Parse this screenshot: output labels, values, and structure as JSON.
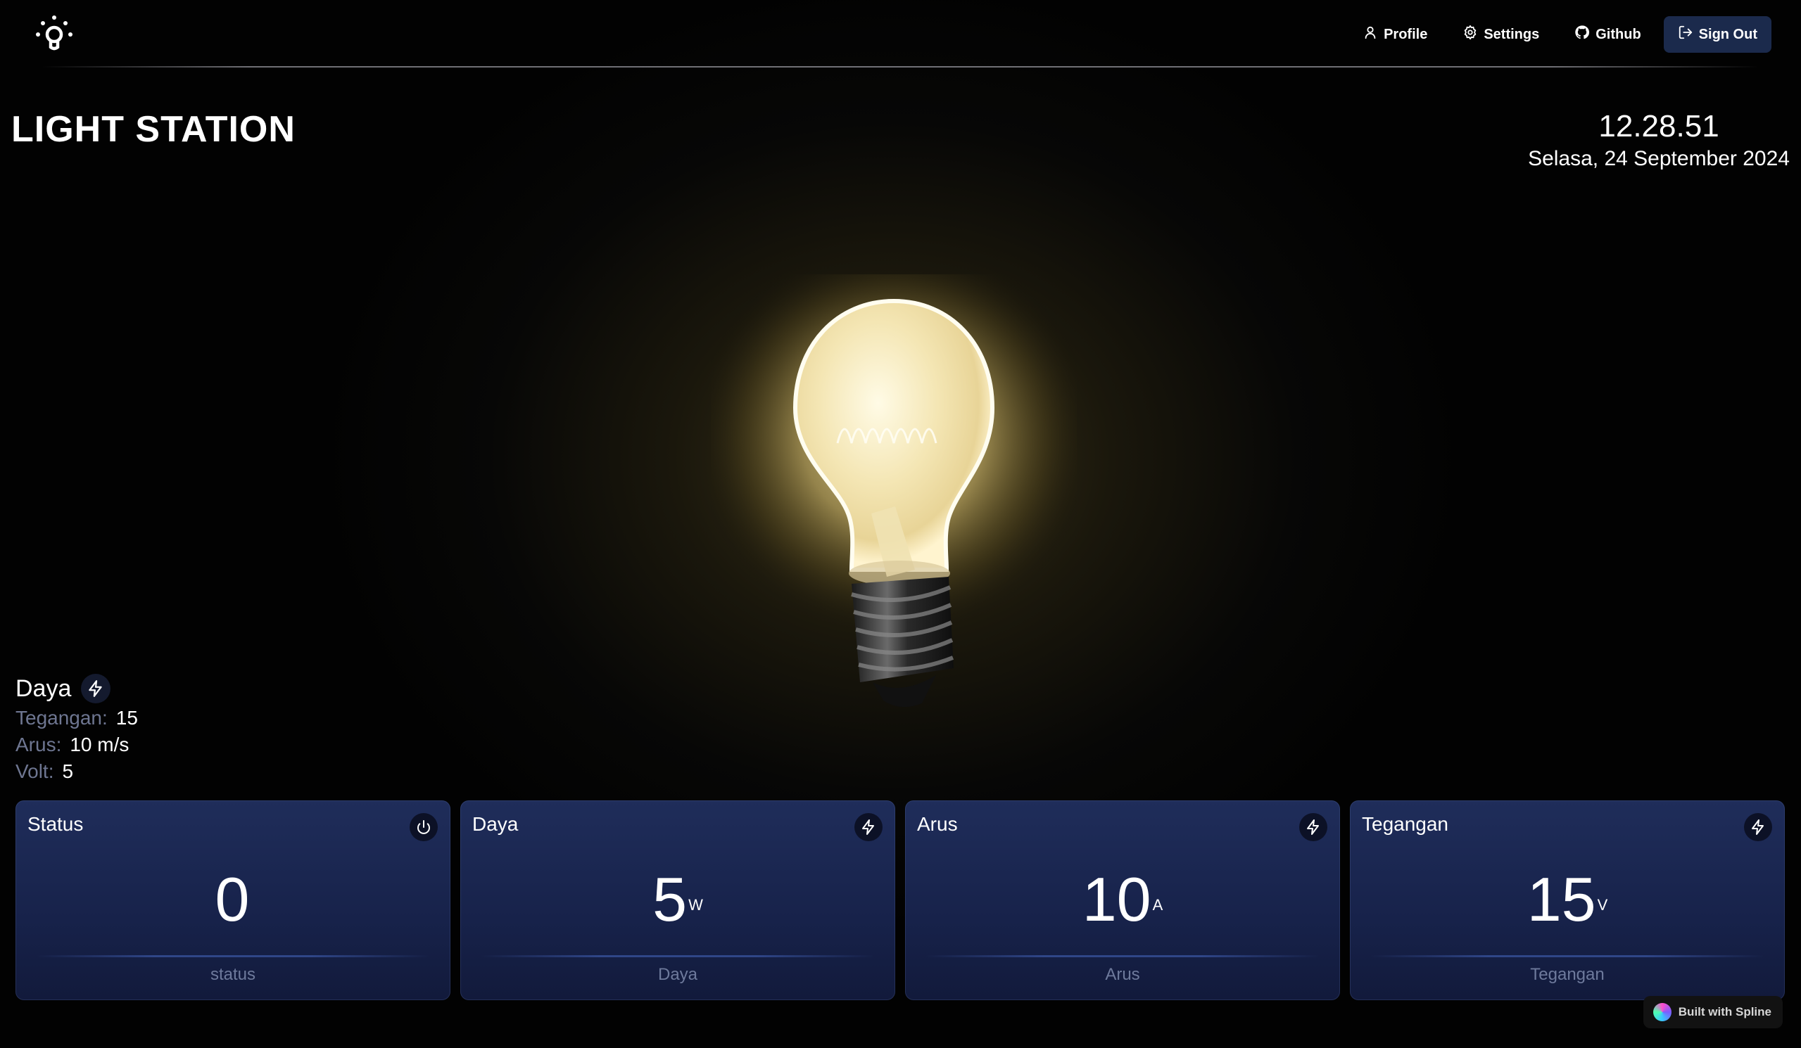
{
  "nav": {
    "profile": "Profile",
    "settings": "Settings",
    "github": "Github",
    "sign_out": "Sign Out"
  },
  "header": {
    "title": "LIGHT STATION",
    "time": "12.28.51",
    "date": "Selasa, 24 September 2024"
  },
  "info": {
    "heading": "Daya",
    "rows": [
      {
        "key": "Tegangan:",
        "value": "15"
      },
      {
        "key": "Arus:",
        "value": "10 m/s"
      },
      {
        "key": "Volt:",
        "value": "5"
      }
    ]
  },
  "cards": [
    {
      "title": "Status",
      "value": "0",
      "unit": "",
      "footer": "status",
      "icon": "power-icon"
    },
    {
      "title": "Daya",
      "value": "5",
      "unit": "W",
      "footer": "Daya",
      "icon": "bolt-icon"
    },
    {
      "title": "Arus",
      "value": "10",
      "unit": "A",
      "footer": "Arus",
      "icon": "bolt-icon"
    },
    {
      "title": "Tegangan",
      "value": "15",
      "unit": "V",
      "footer": "Tegangan",
      "icon": "bolt-icon"
    }
  ],
  "badge": {
    "label": "Built with Spline"
  }
}
